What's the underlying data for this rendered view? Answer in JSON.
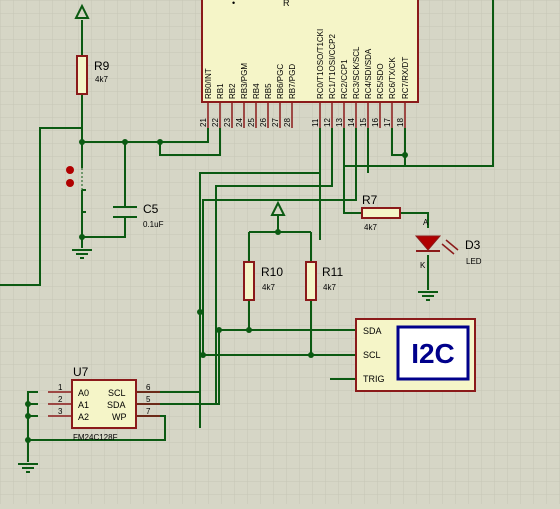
{
  "mcu": {
    "pins": [
      {
        "label": "RB0/INT",
        "num": "21"
      },
      {
        "label": "RB1",
        "num": "22"
      },
      {
        "label": "RB2",
        "num": "23"
      },
      {
        "label": "RB3/PGM",
        "num": "24"
      },
      {
        "label": "RB4",
        "num": "25"
      },
      {
        "label": "RB5",
        "num": "26"
      },
      {
        "label": "RB6/PGC",
        "num": "27"
      },
      {
        "label": "RB7/PGD",
        "num": "28"
      },
      {
        "label": "RC0/T1OSO/T1CKI",
        "num": "11"
      },
      {
        "label": "RC1/T1OSI/CCP2",
        "num": "12"
      },
      {
        "label": "RC2/CCP1",
        "num": "13"
      },
      {
        "label": "RC3/SCK/SCL",
        "num": "14"
      },
      {
        "label": "RC4/SDI/SDA",
        "num": "15"
      },
      {
        "label": "RC5/SDO",
        "num": "16"
      },
      {
        "label": "RC6/TX/CK",
        "num": "17"
      },
      {
        "label": "RC7/RX/DT",
        "num": "18"
      }
    ],
    "top_fragment": "R"
  },
  "r9": {
    "name": "R9",
    "value": "4k7"
  },
  "c5": {
    "name": "C5",
    "value": "0.1uF"
  },
  "r7": {
    "name": "R7",
    "value": "4k7"
  },
  "d3": {
    "name": "D3",
    "value": "LED",
    "anode": "A",
    "cathode": "K"
  },
  "r10": {
    "name": "R10",
    "value": "4k7"
  },
  "r11": {
    "name": "R11",
    "value": "4k7"
  },
  "i2c": {
    "label": "I2C",
    "pins": [
      "SDA",
      "SCL",
      "TRIG"
    ]
  },
  "u7": {
    "name": "U7",
    "part": "FM24C128F",
    "left_pins": [
      {
        "num": "1",
        "label": "A0"
      },
      {
        "num": "2",
        "label": "A1"
      },
      {
        "num": "3",
        "label": "A2"
      }
    ],
    "right_pins": [
      {
        "num": "6",
        "label": "SCL"
      },
      {
        "num": "5",
        "label": "SDA"
      },
      {
        "num": "7",
        "label": "WP"
      }
    ]
  },
  "colors": {
    "background": "#d6d6c6",
    "grid": "#c4c4b4",
    "body": "#f5f5c8",
    "outline": "#8b1a1a",
    "wire": "#0b5a12",
    "text": "#000000",
    "i2c_text": "#00008b",
    "junction": "#0b5a12",
    "led_dot": "#b00000"
  }
}
